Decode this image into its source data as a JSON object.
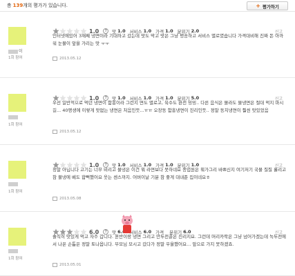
{
  "header": {
    "count_prefix": "총 ",
    "count": "139",
    "count_suffix": "개의 평가가 있습니다.",
    "write_button": "평가하기"
  },
  "labels": {
    "taste": "맛",
    "service": "서비스",
    "price": "가격",
    "mood": "분위기",
    "report": "신고"
  },
  "colors": {
    "star_filled": "#9a9a9a",
    "star_empty": "#e2e2e2",
    "accent": "#e2660e",
    "avatar": "#e6f27a"
  },
  "reviews": [
    {
      "user": "이",
      "user_count": "1회 참여",
      "stars": 1,
      "overall": "1.0",
      "taste": "1.0",
      "service": "1.0",
      "price": "1.0",
      "mood": "2.0",
      "text": "인터넷에있어 3재째 냉면이라 기대하고 갔는데 맛도 막고 맛은 그냥 평송하고 서비스 별로였습니다 가격대비해 진짜 돈 아까워 눈물이 앞을 가리는 맛 ㅜㅜ",
      "date": "2013.05.12"
    },
    {
      "user": "",
      "user_count": "1회 참여",
      "stars": 1,
      "overall": "1.0",
      "taste": "1.0",
      "service": "1.0",
      "price": "1.0",
      "mood": "5.0",
      "text": "우선 일반적으로 먹던 냉면이 함흥이라 그런지 면도 별로고, 육수도 완전 밍밍.. 다른 음식은 몰라도 물냉면은 절대 먹지 마시길... 40평생에 이렇게 맛없는 냉면은 처음인듯...ㅠㅠ 오장동 함흥냉면이 진리인듯.. 정말 동치냉면이 훨씬 맛있었음",
      "date": "2013.05.12"
    },
    {
      "user": "",
      "user_count": "1회 참여",
      "stars": 1,
      "overall": "1.0",
      "taste": "1.0",
      "service": "1.0",
      "price": "1.0",
      "mood": "1.0",
      "text": "정말 아닙니다 고기는 너무 비리고 물냉은 이건 뭐 라면보다 못하네요 종업원은 뭐가그리 바쁘신지 여기저기 국물 질질 흘리고 참 불냉에 베도 합뻑했어요 웃는 센스까지. 어버이날 기분 참 좋게 대내준 집이네요ㅎ",
      "date": "2013.05.08"
    },
    {
      "user": "",
      "user_count": "1회 참여",
      "stars": 3,
      "overall": "6.0",
      "taste": "6.0",
      "service": "6.0",
      "price": "",
      "mood": "6.0",
      "text": "솔직히 맛있게 먹고 자주 갑니다. 혼반이랑 냉면 그리고 만두전골은 진리지요. 그런데 머리카락은 그냥 넘어가겠는데 녹두전에서 나온 손톱은 정말 토나옵니다. 부모님 모시고 갔다가 정말 우울했어요... 앞으로 가지 못하겠죠.",
      "date": "2013.05.01"
    }
  ]
}
